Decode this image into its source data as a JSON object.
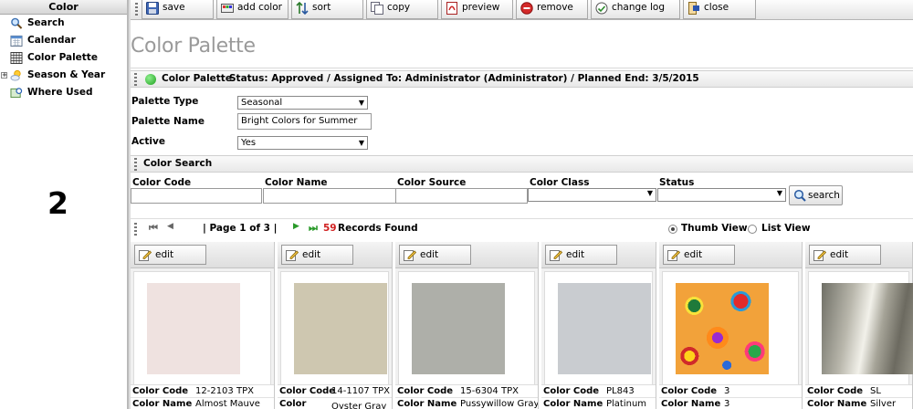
{
  "sidebar": {
    "title": "Color",
    "items": [
      {
        "label": "Search",
        "icon": "magnifier-icon"
      },
      {
        "label": "Calendar",
        "icon": "calendar-icon"
      },
      {
        "label": "Color Palette",
        "icon": "grid-icon"
      },
      {
        "label": "Season & Year",
        "icon": "weather-icon",
        "expandable": true
      },
      {
        "label": "Where Used",
        "icon": "where-used-icon"
      }
    ],
    "step_number": "2"
  },
  "toolbar": {
    "save": "save",
    "add_color": "add color",
    "sort": "sort",
    "copy": "copy",
    "preview": "preview",
    "remove": "remove",
    "change_log": "change log",
    "close": "close"
  },
  "page": {
    "title": "Color Palette",
    "status_name": "Color Palette",
    "status_text": "Status: Approved / Assigned To: Administrator (Administrator) / Planned End: 3/5/2015",
    "status_color": "#2fbf2f"
  },
  "form": {
    "palette_type_label": "Palette Type",
    "palette_type_value": "Seasonal",
    "palette_name_label": "Palette Name",
    "palette_name_value": "Bright Colors for Summer",
    "active_label": "Active",
    "active_value": "Yes"
  },
  "color_search": {
    "title": "Color Search",
    "columns": [
      "Color Code",
      "Color Name",
      "Color Source",
      "Color Class",
      "Status"
    ],
    "search_button": "search"
  },
  "pager": {
    "page_text": "| Page 1 of 3 |",
    "record_count": "59",
    "records_label": "Records Found",
    "thumb_view": "Thumb View",
    "list_view": "List View",
    "selected_view": "thumb"
  },
  "cards": [
    {
      "edit": "edit",
      "code_label": "Color Code",
      "code": "12-2103 TPX",
      "name_label": "Color Name",
      "name": "Almost Mauve",
      "swatch": "#efe2e0"
    },
    {
      "edit": "edit",
      "code_label": "Color Code",
      "code": "14-1107 TPX",
      "name_label": "Color",
      "name": "Oyster Gray",
      "swatch": "#cec7b0"
    },
    {
      "edit": "edit",
      "code_label": "Color Code",
      "code": "15-6304 TPX",
      "name_label": "Color Name",
      "name": "Pussywillow Gray",
      "swatch": "#aeafa9"
    },
    {
      "edit": "edit",
      "code_label": "Color Code",
      "code": "PL843",
      "name_label": "Color Name",
      "name": "Platinum",
      "swatch": "#c9ccd0"
    },
    {
      "edit": "edit",
      "code_label": "Color Code",
      "code": "3",
      "name_label": "Color Name",
      "name": "3",
      "swatch": "pattern"
    },
    {
      "edit": "edit",
      "code_label": "Color Code",
      "code": "SL",
      "name_label": "Color Name",
      "name": "Silver",
      "swatch": "metal"
    }
  ]
}
